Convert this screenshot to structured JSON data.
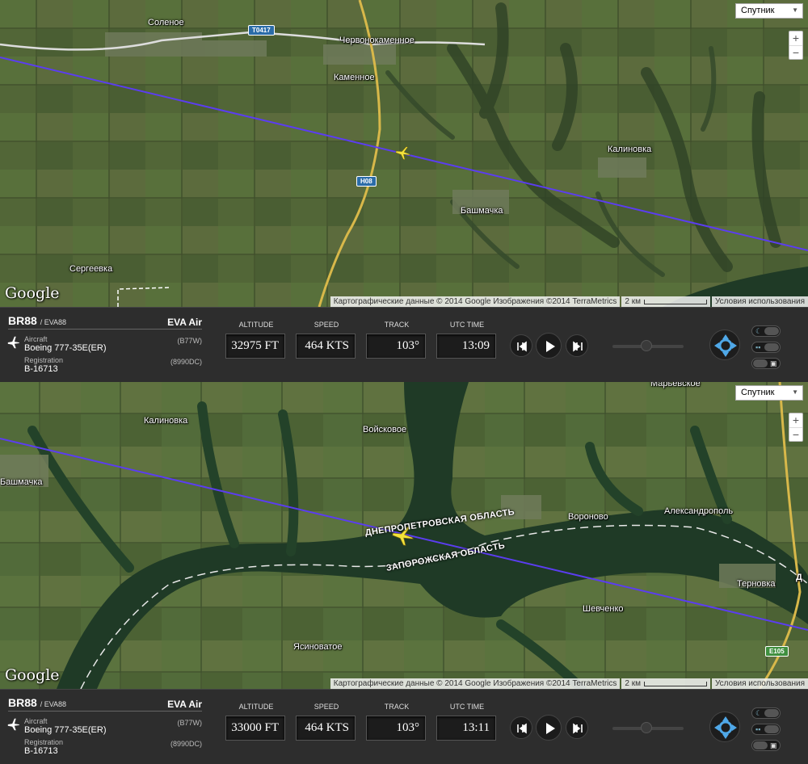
{
  "panels": [
    {
      "map": {
        "map_type": "Спутник",
        "zoom_in": "+",
        "zoom_out": "−",
        "google_logo": "Google",
        "attribution": "Картографические данные © 2014 Google Изображения ©2014 TerraMetrics",
        "scale_label": "2 км",
        "terms": "Условия использования",
        "places": [
          "Соленое",
          "Червонокаменное",
          "Каменное",
          "Калиновка",
          "Башмачка",
          "Сергеевка"
        ],
        "road_shields": [
          "T0417",
          "H08"
        ]
      },
      "flight": {
        "callsign": "BR88",
        "icao_callsign": "/ EVA88",
        "airline": "EVA Air",
        "aircraft_label": "Aircraft",
        "aircraft": "Boeing 777-35E(ER)",
        "aircraft_code": "(B77W)",
        "registration_label": "Registration",
        "registration": "B-16713",
        "registration_code": "(8990DC)"
      },
      "stats": {
        "altitude_label": "ALTITUDE",
        "altitude": "32975 FT",
        "speed_label": "SPEED",
        "speed": "464 KTS",
        "track_label": "TRACK",
        "track": "103°",
        "time_label": "UTC TIME",
        "time": "13:09"
      }
    },
    {
      "map": {
        "map_type": "Спутник",
        "zoom_in": "+",
        "zoom_out": "−",
        "google_logo": "Google",
        "attribution": "Картографические данные © 2014 Google Изображения ©2014 TerraMetrics",
        "scale_label": "2 км",
        "terms": "Условия использования",
        "places": [
          "Марьевское",
          "Калиновка",
          "Войсковое",
          "Башмачка",
          "Вороново",
          "Александрополь",
          "Терновка",
          "Шевченко",
          "Ясиноватое"
        ],
        "regions": [
          "ДНЕПРОПЕТРОВСКАЯ ОБЛАСТЬ",
          "ЗАПОРОЖСКАЯ ОБЛАСТЬ"
        ],
        "road_shields": [
          "E105",
          "Д"
        ]
      },
      "flight": {
        "callsign": "BR88",
        "icao_callsign": "/ EVA88",
        "airline": "EVA Air",
        "aircraft_label": "Aircraft",
        "aircraft": "Boeing 777-35E(ER)",
        "aircraft_code": "(B77W)",
        "registration_label": "Registration",
        "registration": "B-16713",
        "registration_code": "(8990DC)"
      },
      "stats": {
        "altitude_label": "ALTITUDE",
        "altitude": "33000 FT",
        "speed_label": "SPEED",
        "speed": "464 KTS",
        "track_label": "TRACK",
        "track": "103°",
        "time_label": "UTC TIME",
        "time": "13:11"
      }
    }
  ],
  "colors": {
    "flight_path": "#5b3df0",
    "plane": "#f3e23a",
    "terrain": "#4d6137",
    "water": "#1f3a26",
    "bar_bg": "#2d2d2d",
    "control_accent": "#4fa8e8"
  }
}
